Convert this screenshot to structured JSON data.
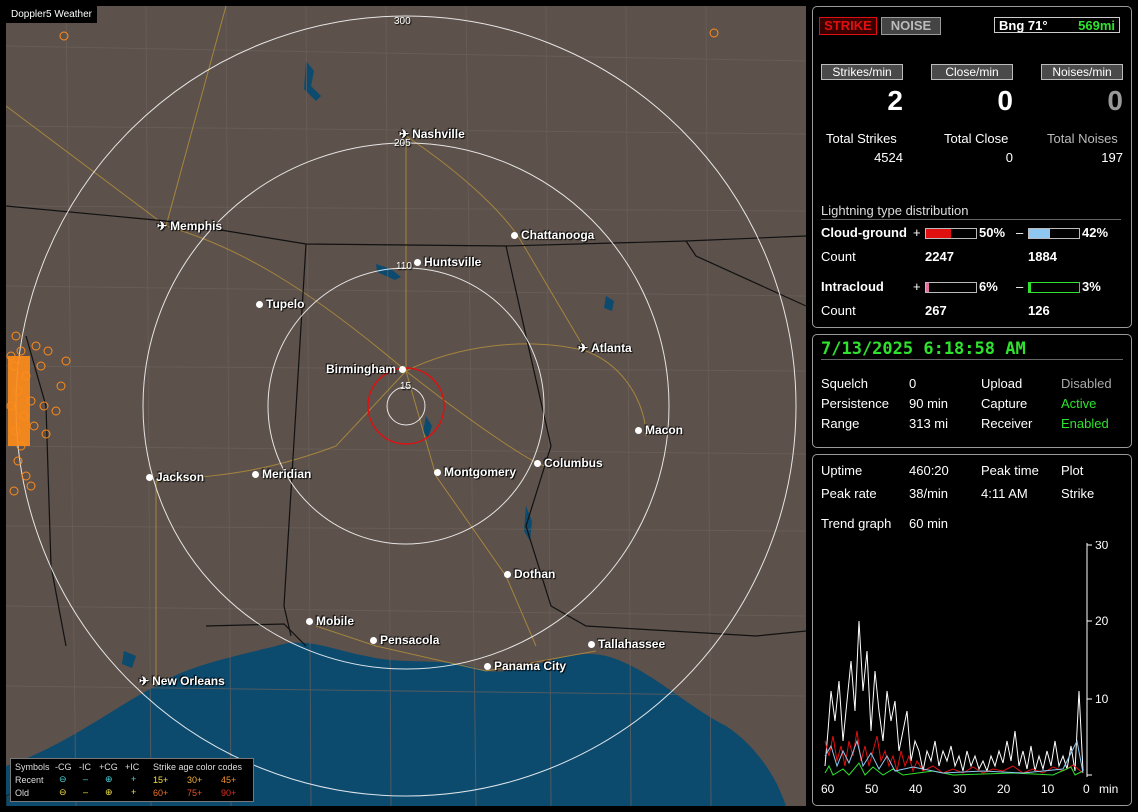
{
  "map": {
    "title": "Doppler5 Weather",
    "ring_labels": [
      "300",
      "205",
      "110",
      "15"
    ],
    "cities": [
      {
        "name": "Nashville",
        "airport": true
      },
      {
        "name": "Memphis",
        "airport": true
      },
      {
        "name": "Chattanooga",
        "airport": false
      },
      {
        "name": "Huntsville",
        "airport": false
      },
      {
        "name": "Tupelo",
        "airport": false
      },
      {
        "name": "Atlanta",
        "airport": true
      },
      {
        "name": "Birmingham",
        "airport": false
      },
      {
        "name": "Macon",
        "airport": false
      },
      {
        "name": "Jackson",
        "airport": false
      },
      {
        "name": "Meridian",
        "airport": false
      },
      {
        "name": "Montgomery",
        "airport": false
      },
      {
        "name": "Columbus",
        "airport": false
      },
      {
        "name": "Dothan",
        "airport": false
      },
      {
        "name": "Mobile",
        "airport": false
      },
      {
        "name": "Pensacola",
        "airport": false
      },
      {
        "name": "Tallahassee",
        "airport": false
      },
      {
        "name": "Panama City",
        "airport": false
      },
      {
        "name": "New Orleans",
        "airport": true
      }
    ],
    "legend": {
      "symbols_label": "Symbols",
      "cols": [
        "-CG",
        "-IC",
        "+CG",
        "+IC"
      ],
      "age_label": "Strike age color codes",
      "recent_label": "Recent",
      "old_label": "Old",
      "recent_codes": [
        "15+",
        "30+",
        "45+"
      ],
      "old_codes": [
        "60+",
        "75+",
        "90+"
      ]
    }
  },
  "header": {
    "strike_btn": "STRIKE",
    "noise_btn": "NOISE",
    "bearing": "Bng 71°",
    "distance": "569mi"
  },
  "counters": {
    "strikes_label": "Strikes/min",
    "close_label": "Close/min",
    "noises_label": "Noises/min",
    "strikes_value": "2",
    "close_value": "0",
    "noises_value": "0",
    "total_strikes_label": "Total Strikes",
    "total_close_label": "Total Close",
    "total_noises_label": "Total Noises",
    "total_strikes": "4524",
    "total_close": "0",
    "total_noises": "197"
  },
  "distribution": {
    "title": "Lightning type distribution",
    "cg_label": "Cloud-ground",
    "ic_label": "Intracloud",
    "count_label": "Count",
    "plus": "+",
    "minus": "–",
    "cg_pos_pct": "50%",
    "cg_neg_pct": "42%",
    "ic_pos_pct": "6%",
    "ic_neg_pct": "3%",
    "cg_pos_count": "2247",
    "cg_neg_count": "1884",
    "ic_pos_count": "267",
    "ic_neg_count": "126",
    "cg_pos_frac": 0.5,
    "cg_neg_frac": 0.42,
    "ic_pos_frac": 0.06,
    "ic_neg_frac": 0.03
  },
  "status": {
    "datetime": "7/13/2025 6:18:58 AM",
    "squelch_label": "Squelch",
    "squelch": "0",
    "persistence_label": "Persistence",
    "persistence": "90 min",
    "range_label": "Range",
    "range": "313 mi",
    "upload_label": "Upload",
    "upload": "Disabled",
    "capture_label": "Capture",
    "capture": "Active",
    "receiver_label": "Receiver",
    "receiver": "Enabled"
  },
  "trend": {
    "uptime_label": "Uptime",
    "uptime": "460:20",
    "peak_time_label": "Peak time",
    "peak_time": "4:11 AM",
    "plot_label": "Plot",
    "plot": "Strike",
    "peak_rate_label": "Peak rate",
    "peak_rate": "38/min",
    "trend_label": "Trend graph",
    "trend": "60 min",
    "y_ticks": [
      "30",
      "20",
      "10",
      "0"
    ],
    "x_ticks": [
      "60",
      "50",
      "40",
      "30",
      "20",
      "10",
      "0"
    ],
    "x_unit": "min"
  },
  "colors": {
    "strike_red": "#e01010",
    "active_green": "#2ee22e",
    "cg_neg_blue": "#8ec8f0",
    "ic_pos_pink": "#e070a0",
    "strike_orange": "#ff8c1a",
    "water": "#0c4a6e",
    "land": "#5c514b"
  }
}
